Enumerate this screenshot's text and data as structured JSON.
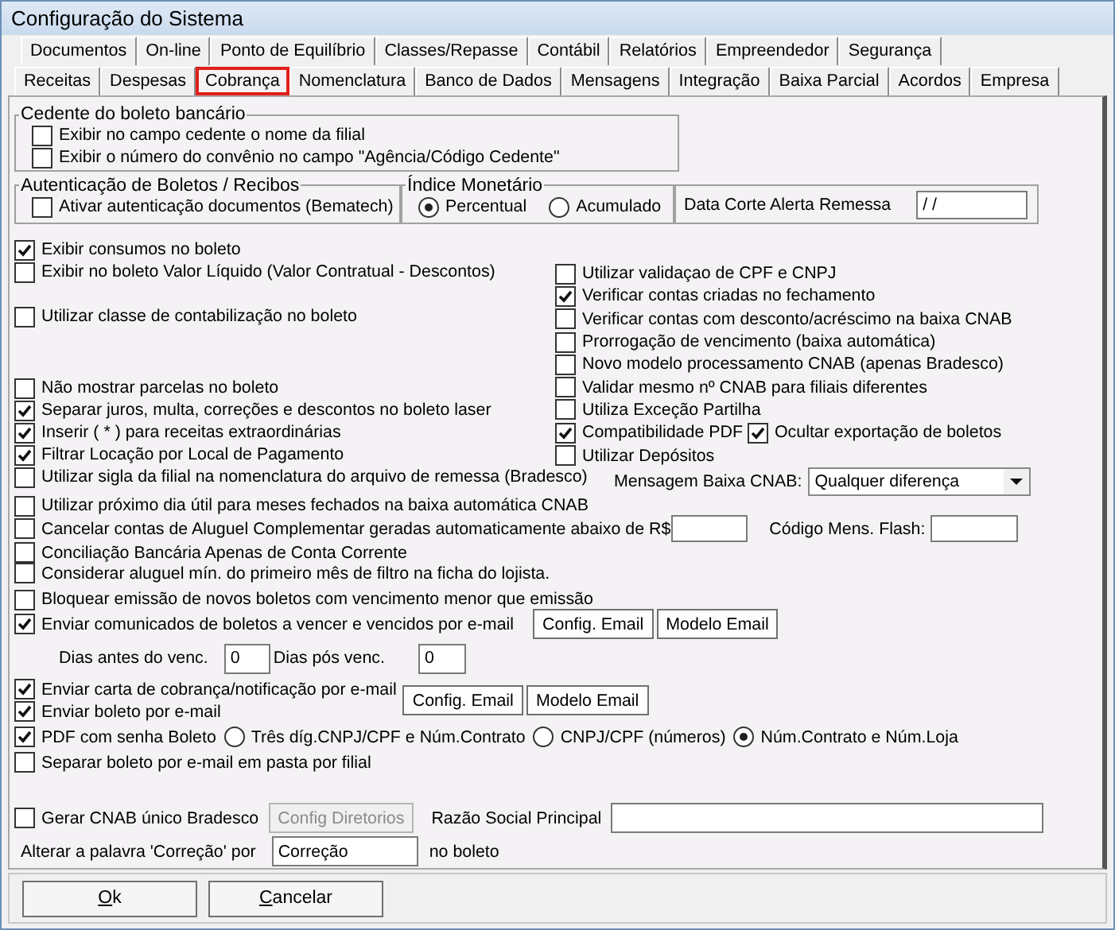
{
  "window": {
    "title": "Configuração do Sistema"
  },
  "tab_rows": [
    [
      {
        "label": "Documentos",
        "selected": false
      },
      {
        "label": "On-line",
        "selected": false
      },
      {
        "label": "Ponto de Equilíbrio",
        "selected": false
      },
      {
        "label": "Classes/Repasse",
        "selected": false
      },
      {
        "label": "Contábil",
        "selected": false
      },
      {
        "label": "Relatórios",
        "selected": false
      },
      {
        "label": "Empreendedor",
        "selected": false
      },
      {
        "label": "Segurança",
        "selected": false
      }
    ],
    [
      {
        "label": "Receitas",
        "selected": false
      },
      {
        "label": "Despesas",
        "selected": false
      },
      {
        "label": "Cobrança",
        "selected": true
      },
      {
        "label": "Nomenclatura",
        "selected": false
      },
      {
        "label": "Banco de Dados",
        "selected": false
      },
      {
        "label": "Mensagens",
        "selected": false
      },
      {
        "label": "Integração",
        "selected": false
      },
      {
        "label": "Baixa Parcial",
        "selected": false
      },
      {
        "label": "Acordos",
        "selected": false
      },
      {
        "label": "Empresa",
        "selected": false
      }
    ]
  ],
  "cedente_group": {
    "title": "Cedente do boleto bancário",
    "options": [
      {
        "label": "Exibir no campo cedente o nome da filial",
        "checked": false
      },
      {
        "label": "Exibir o número do convênio no campo \"Agência/Código Cedente\"",
        "checked": false
      }
    ]
  },
  "autenticacao_group": {
    "title": "Autenticação de Boletos / Recibos",
    "option": {
      "label": "Ativar autenticação documentos (Bematech)",
      "checked": false
    }
  },
  "indice_group": {
    "title": "Índice Monetário",
    "options": [
      {
        "label": "Percentual",
        "selected": true
      },
      {
        "label": "Acumulado",
        "selected": false
      }
    ]
  },
  "data_corte": {
    "label": "Data Corte Alerta Remessa",
    "value": "/ /"
  },
  "left_column": [
    [
      {
        "label": "Exibir consumos no boleto",
        "checked": true
      },
      {
        "label": "Exibir no boleto Valor Líquido (Valor Contratual - Descontos)",
        "checked": false
      }
    ],
    [
      {
        "label": "Utilizar classe de contabilização no boleto",
        "checked": false
      }
    ],
    [
      {
        "label": "Não mostrar parcelas no boleto",
        "checked": false
      },
      {
        "label": "Separar juros, multa, correções e descontos no boleto laser",
        "checked": true
      },
      {
        "label": "Inserir ( * ) para receitas extraordinárias",
        "checked": true
      },
      {
        "label": "Filtrar Locação por Local de Pagamento",
        "checked": true
      },
      {
        "label": "Utilizar sigla da filial na nomenclatura do arquivo de remessa (Bradesco)",
        "checked": false
      }
    ]
  ],
  "right_column": [
    {
      "kind": "checkbox",
      "label": "Utilizar validaçao de CPF e CNPJ",
      "checked": false
    },
    {
      "kind": "checkbox",
      "label": "Verificar contas criadas no fechamento",
      "checked": true
    },
    {
      "kind": "checkbox",
      "label": "Verificar contas com desconto/acréscimo na baixa CNAB",
      "checked": false
    },
    {
      "kind": "checkbox",
      "label": "Prorrogação de vencimento (baixa automática)",
      "checked": false
    },
    {
      "kind": "checkbox",
      "label": "Novo modelo processamento CNAB (apenas Bradesco)",
      "checked": false
    },
    {
      "kind": "checkbox",
      "label": "Validar mesmo nº CNAB para filiais diferentes",
      "checked": false
    },
    {
      "kind": "checkbox",
      "label": "Utiliza Exceção Partilha",
      "checked": false
    },
    {
      "kind": "pair",
      "items": [
        {
          "label": "Compatibilidade PDF",
          "checked": true
        },
        {
          "label": "Ocultar exportação de boletos",
          "checked": true
        }
      ]
    },
    {
      "kind": "checkbox",
      "label": "Utilizar Depósitos",
      "checked": false
    },
    {
      "kind": "select",
      "label": "Mensagem Baixa CNAB:",
      "value": "Qualquer diferença"
    }
  ],
  "rows": [
    {
      "kind": "checkbox",
      "label": "Utilizar próximo dia útil para meses fechados na baixa automática CNAB",
      "checked": false
    },
    {
      "kind": "checkbox_fields",
      "label": "Cancelar contas de Aluguel Complementar geradas automaticamente abaixo de R$",
      "checked": false,
      "field_label": "Código Mens. Flash:"
    },
    {
      "kind": "checkbox",
      "label": "Conciliação Bancária Apenas de Conta Corrente",
      "checked": false
    },
    {
      "kind": "checkbox",
      "label": "Considerar aluguel mín. do primeiro mês de filtro na ficha do lojista.",
      "checked": false
    },
    {
      "kind": "checkbox",
      "label": "Bloquear emissão de novos boletos com vencimento menor que emissão",
      "checked": false
    },
    {
      "kind": "checkbox_buttons",
      "label": "Enviar comunicados de boletos a vencer e vencidos por e-mail",
      "checked": true,
      "buttons": [
        "Config. Email",
        "Modelo Email"
      ]
    },
    {
      "kind": "days",
      "before_label": "Dias antes do venc.",
      "before_value": "0",
      "after_label": "Dias pós venc.",
      "after_value": "0"
    },
    {
      "kind": "group_buttons",
      "items": [
        {
          "label": "Enviar carta de cobrança/notificação por e-mail",
          "checked": true
        },
        {
          "label": "Enviar boleto por e-mail",
          "checked": true
        }
      ],
      "buttons": [
        "Config. Email",
        "Modelo Email"
      ]
    },
    {
      "kind": "checkbox_radios",
      "label": "PDF com senha Boleto",
      "checked": true,
      "radios": [
        {
          "label": "Três díg.CNPJ/CPF e Núm.Contrato",
          "selected": false
        },
        {
          "label": "CNPJ/CPF (números)",
          "selected": false
        },
        {
          "label": "Núm.Contrato e Núm.Loja",
          "selected": true
        }
      ]
    },
    {
      "kind": "checkbox",
      "label": "Separar boleto por e-mail em pasta por filial",
      "checked": false
    },
    {
      "kind": "cnab",
      "label": "Gerar CNAB único Bradesco",
      "checked": false,
      "button": {
        "label": "Config Diretorios",
        "disabled": true
      },
      "field_label": "Razão Social Principal"
    },
    {
      "kind": "replace",
      "label": "Alterar a palavra 'Correção' por",
      "value": "Correção",
      "suffix": "no boleto"
    }
  ],
  "footer_buttons": [
    "Ok",
    "Cancelar"
  ]
}
